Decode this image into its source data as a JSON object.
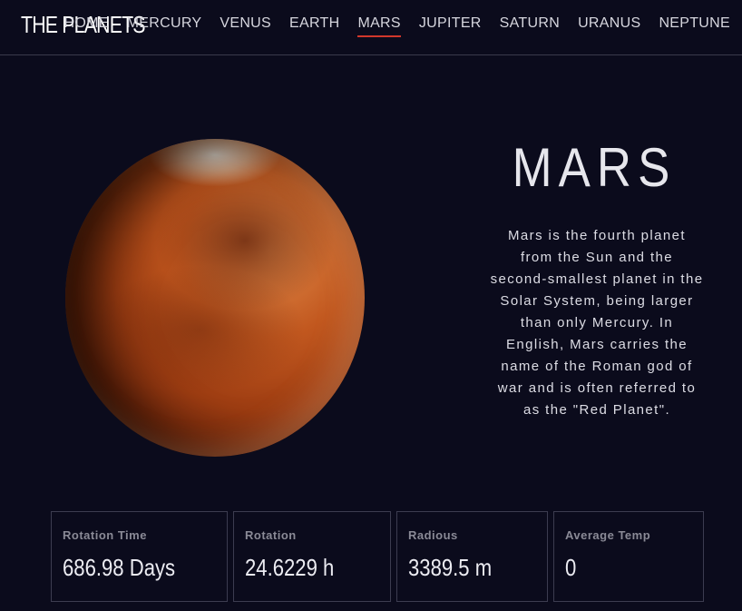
{
  "brand": {
    "title": "THE PLANETS"
  },
  "nav": {
    "items": [
      {
        "label": "HOME"
      },
      {
        "label": "MERCURY"
      },
      {
        "label": "VENUS"
      },
      {
        "label": "EARTH"
      },
      {
        "label": "MARS",
        "active": true
      },
      {
        "label": "JUPITER"
      },
      {
        "label": "SATURN"
      },
      {
        "label": "URANUS"
      },
      {
        "label": "NEPTUNE"
      }
    ],
    "active_color": "#d1372b"
  },
  "planet": {
    "name": "MARS",
    "image": "mars-planet-image",
    "description": "Mars is the fourth planet from the Sun and the second-smallest planet in the Solar System, being larger than only Mercury. In English, Mars carries the name of the Roman god of war and is often referred to as the \"Red Planet\"."
  },
  "stats": [
    {
      "label": "Rotation Time",
      "value": "686.98 Days"
    },
    {
      "label": "Rotation",
      "value": "24.6229 h"
    },
    {
      "label": "Radious",
      "value": "3389.5 m"
    },
    {
      "label": "Average Temp",
      "value": "0"
    }
  ],
  "colors": {
    "background": "#0b0b1c",
    "border": "#3c3c50"
  }
}
